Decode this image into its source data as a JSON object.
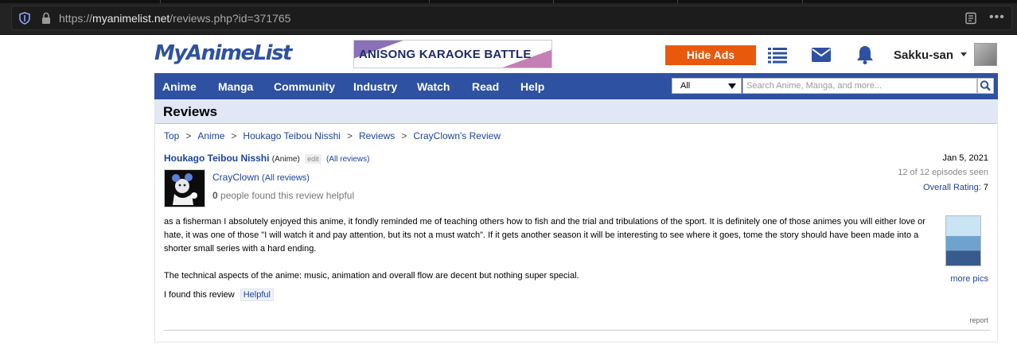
{
  "browser": {
    "url_scheme": "https://",
    "url_host": "myanimelist.net",
    "url_path": "/reviews.php?id=371765"
  },
  "header": {
    "logo": "MyAnimeList",
    "ad_text": "ANISONG KARAOKE BATTLE",
    "hide_ads": "Hide Ads",
    "username": "Sakku-san"
  },
  "nav": {
    "items": [
      "Anime",
      "Manga",
      "Community",
      "Industry",
      "Watch",
      "Read",
      "Help"
    ],
    "search_category": "All",
    "search_placeholder": "Search Anime, Manga, and more..."
  },
  "page": {
    "title": "Reviews"
  },
  "breadcrumb": [
    "Top",
    "Anime",
    "Houkago Teibou Nisshi",
    "Reviews",
    "CrayClown's Review"
  ],
  "review": {
    "anime_title": "Houkago Teibou Nisshi",
    "anime_type": "(Anime)",
    "edit_label": "edit",
    "all_reviews_label": "(All reviews)",
    "reviewer": "CrayClown",
    "reviewer_all_reviews": "(All reviews)",
    "helpful_count": "0",
    "helpful_text": "people found this review helpful",
    "date": "Jan 5, 2021",
    "episodes_seen": "12 of 12 episodes seen",
    "overall_rating_label": "Overall Rating",
    "overall_rating_value": "7",
    "body_p1": "as a fisherman I absolutely enjoyed this anime, it fondly reminded me of teaching others how to fish and the trial and tribulations of the sport. It is definitely one of those animes you will either love or hate, it was one of those \"I will watch it and pay attention, but its not a must watch\". If it gets another season it will be interesting to see where it goes, tome the story should have been made into a shorter small series with a hard ending.",
    "body_p2": "The technical aspects of the anime: music, animation and overall flow are decent but nothing super special.",
    "found_label": "I found this review",
    "helpful_button": "Helpful",
    "more_pics": "more pics",
    "report": "report"
  }
}
